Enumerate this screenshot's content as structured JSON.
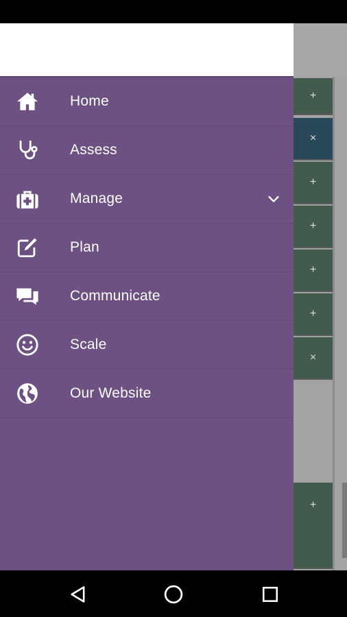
{
  "menu": {
    "items": [
      {
        "label": "Home",
        "icon": "home-icon"
      },
      {
        "label": "Assess",
        "icon": "stethoscope-icon"
      },
      {
        "label": "Manage",
        "icon": "medkit-icon",
        "expandable": true
      },
      {
        "label": "Plan",
        "icon": "edit-icon"
      },
      {
        "label": "Communicate",
        "icon": "chat-icon"
      },
      {
        "label": "Scale",
        "icon": "smile-icon"
      },
      {
        "label": "Our Website",
        "icon": "globe-icon"
      }
    ]
  },
  "background": {
    "buttons": [
      "+",
      "×",
      "+",
      "+",
      "+",
      "+",
      "×",
      "+"
    ]
  },
  "colors": {
    "drawer": "#6c5182",
    "row_green": "#435b4f",
    "row_blue": "#29495a"
  },
  "nav": {
    "back": "back-icon",
    "home": "home-circle-icon",
    "recents": "recents-icon"
  }
}
